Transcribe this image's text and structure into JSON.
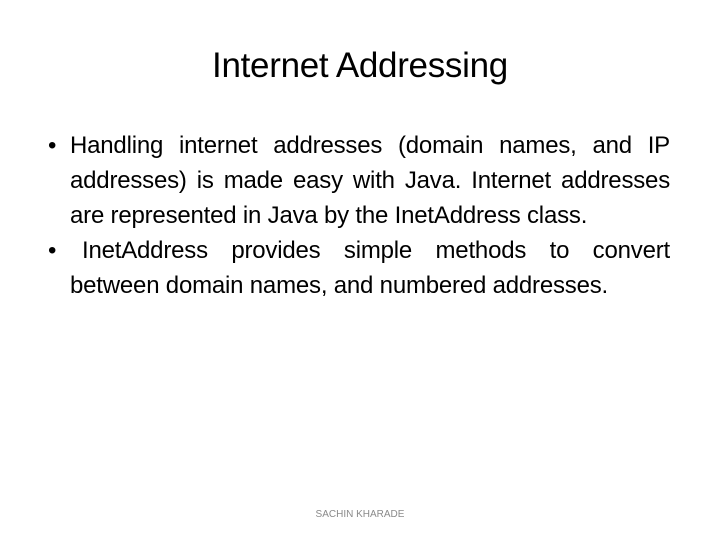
{
  "slide": {
    "title": "Internet Addressing",
    "bullets": [
      {
        "marker": "•",
        "text": "Handling internet addresses (domain names, and IP addresses) is made easy with Java. Internet addresses are represented in Java by the InetAddress class."
      },
      {
        "marker": "•",
        "text": "InetAddress provides simple methods to convert between domain names, and numbered addresses."
      }
    ],
    "footer": "SACHIN KHARADE"
  }
}
